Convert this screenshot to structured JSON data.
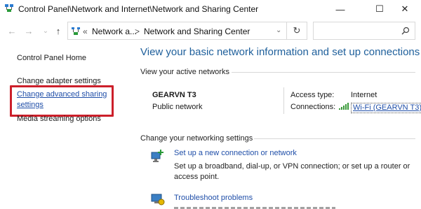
{
  "window": {
    "title": "Control Panel\\Network and Internet\\Network and Sharing Center",
    "minimize": "—",
    "maximize": "☐",
    "close": "✕"
  },
  "nav": {
    "back": "←",
    "forward": "→",
    "up": "↑",
    "recent": "⌄",
    "crumbs_prefix": "«",
    "crumb1": "Network a...",
    "crumb_sep": ">",
    "crumb2": "Network and Sharing Center",
    "refresh": "↻",
    "search_placeholder": ""
  },
  "sidebar": {
    "home": "Control Panel Home",
    "adapter": "Change adapter settings",
    "advanced": "Change advanced sharing settings",
    "media": "Media streaming options"
  },
  "main": {
    "title": "View your basic network information and set up connections",
    "active_header": "View your active networks",
    "network_name": "GEARVN T3",
    "network_type": "Public network",
    "access_label": "Access type:",
    "access_value": "Internet",
    "connections_label": "Connections:",
    "connections_value": "Wi-Fi (GEARVN T3)",
    "change_header": "Change your networking settings",
    "task1_link": "Set up a new connection or network",
    "task1_desc": "Set up a broadband, dial-up, or VPN connection; or set up a router or access point.",
    "task2_link": "Troubleshoot problems"
  },
  "colors": {
    "accent_link": "#1f4ea8",
    "title_blue": "#1e5f9b",
    "highlight_red": "#cc1f2a"
  }
}
